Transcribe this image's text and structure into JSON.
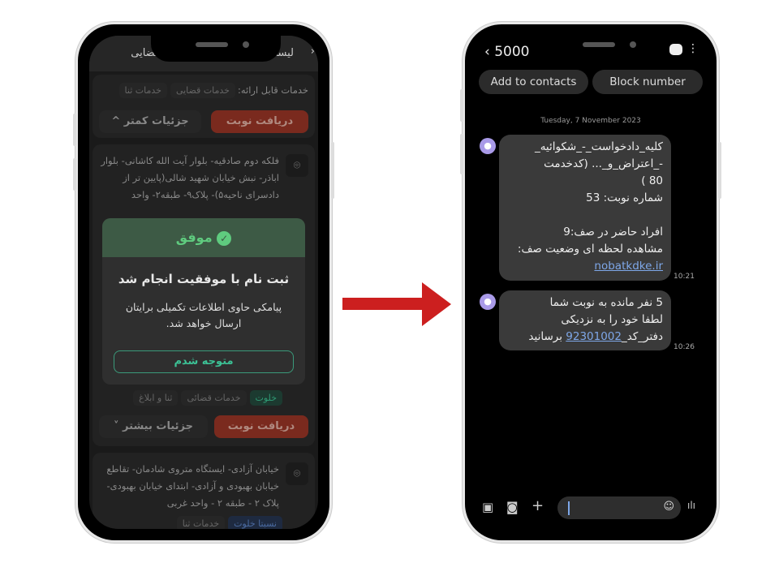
{
  "left_phone": {
    "header": {
      "title": "لیست دفاتر خدمات الکترونیک قضایی",
      "back_icon": "chevron-right-icon"
    },
    "card1": {
      "services_label": "خدمات قابل ارائه:",
      "chips": [
        "خدمات قضایی",
        "خدمات ثنا"
      ],
      "get_turn": "دریافت نوبت",
      "details": "جزئیات کمتر ^"
    },
    "card2": {
      "address": "فلکه دوم صادقیه- بلوار آیت الله کاشانی- بلوار اباذر- نبش خیابان شهید شالی(پایین تر از دادسرای ناحیه۵)- پلاک۹- طبقه۲- واحد",
      "chips": [
        "خلوت",
        "خدمات قضائی",
        "ثنا و ابلاغ"
      ],
      "get_turn": "دریافت نوبت",
      "details": "جزئیات بیشتر"
    },
    "card3": {
      "address": "خیابان آزادی- ایستگاه متروی شادمان- تقاطع خیابان بهبودی و آزادی- ابتدای خیابان بهبودی- پلاک ۲ - طبقه ۲ - واحد غربی",
      "chips": [
        "نسبتا خلوت",
        "خدمات ثنا"
      ]
    },
    "modal": {
      "status": "موفق",
      "title": "ثبت نام با موفقیت انجام شد",
      "body": "پیامکی حاوی اطلاعات تکمیلی برایتان ارسال خواهد شد.",
      "button": "متوجه شدم"
    }
  },
  "right_phone": {
    "header": {
      "sender": "5000",
      "back_icon": "chevron-left-icon"
    },
    "add_contact": "Add to contacts",
    "block": "Block number",
    "date": "Tuesday, 7 November 2023",
    "messages": [
      {
        "lines": [
          "کلیه_دادخواست_-_شکوائیه_",
          "-_اعتراض_و_... (کدخدمت",
          "80 )",
          "شماره نوبت: 53",
          "",
          "افراد حاضر در صف:9",
          "مشاهده لحظه ای وضعیت صف:"
        ],
        "link": "nobatkdke.ir",
        "time": "10:21"
      },
      {
        "lines": [
          "5 نفر مانده به نوبت شما",
          "لطفا خود را به نزدیکی"
        ],
        "last_prefix": "دفتر_کد_",
        "link": "92301002",
        "last_suffix": " برسانید",
        "time": "10:26"
      }
    ]
  },
  "colors": {
    "accent_red": "#cc1f1f",
    "success": "#5fcb7f",
    "link": "#7ea7e8"
  }
}
